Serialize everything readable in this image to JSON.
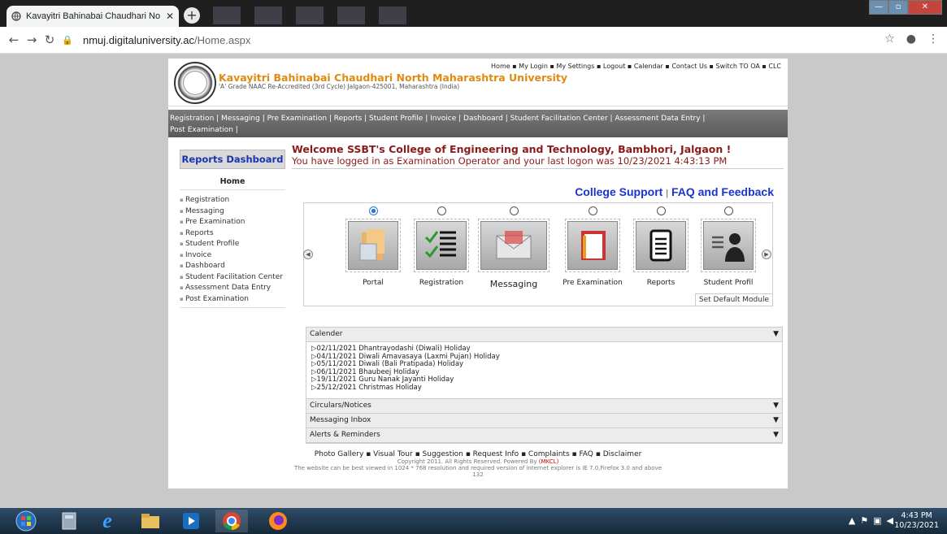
{
  "browser": {
    "tab_title": "Kavayitri Bahinabai Chaudhari No",
    "url_host": "nmuj.digitaluniversity.ac",
    "url_path": "/Home.aspx"
  },
  "header": {
    "university_name": "Kavayitri Bahinabai Chaudhari North Maharashtra University",
    "university_sub": "'A' Grade NAAC Re-Accredited (3rd Cycle) Jalgaon-425001, Maharashtra (India)",
    "top_links": "Home  ▪ My Login  ▪ My Settings  ▪ Logout  ▪ Calendar  ▪ Contact Us  ▪ Switch TO OA  ▪ CLC"
  },
  "menu": {
    "line1": "Registration | Messaging | Pre Examination | Reports | Student Profile | Invoice | Dashboard | Student Facilitation Center | Assessment Data Entry |",
    "line2": "Post Examination |"
  },
  "sidebar": {
    "button": "Reports Dashboard",
    "home": "Home",
    "items": [
      "Registration",
      "Messaging",
      "Pre Examination",
      "Reports",
      "Student Profile",
      "Invoice",
      "Dashboard",
      "Student Facilitation Center",
      "Assessment Data Entry",
      "Post Examination"
    ]
  },
  "main": {
    "welcome": "Welcome SSBT's College of Engineering and Technology, Bambhori, Jalgaon !",
    "logged": "You have logged in as Examination Operator and your last logon was 10/23/2021 4:43:13 PM",
    "support": "College Support",
    "sep": "|",
    "faq": "FAQ and Feedback",
    "set_default": "Set Default Module"
  },
  "modules": [
    {
      "label": "Portal",
      "icon": "portal-icon",
      "selected": true
    },
    {
      "label": "Registration",
      "icon": "checklist-icon",
      "selected": false
    },
    {
      "label": "Messaging",
      "icon": "envelope-icon",
      "selected": false
    },
    {
      "label": "Pre Examination",
      "icon": "notepad-icon",
      "selected": false
    },
    {
      "label": "Reports",
      "icon": "document-icon",
      "selected": false
    },
    {
      "label": "Student Profil",
      "icon": "user-profile-icon",
      "selected": false
    }
  ],
  "accordion": {
    "calender": "Calender",
    "events": [
      "02/11/2021 Dhantrayodashi (Diwali) Holiday",
      "04/11/2021 Diwali Amavasaya (Laxmi Pujan) Holiday",
      "05/11/2021 Diwali (Bali Pratipada) Holiday",
      "06/11/2021 Bhaubeej Holiday",
      "19/11/2021 Guru Nanak Jayanti Holiday",
      "25/12/2021 Christmas Holiday"
    ],
    "circulars": "Circulars/Notices",
    "inbox": "Messaging Inbox",
    "alerts": "Alerts & Reminders"
  },
  "footer": {
    "links": "Photo Gallery  ▪ Visual Tour  ▪ Suggestion  ▪ Request Info  ▪ Complaints  ▪ FAQ  ▪ Disclaimer",
    "copyright": "Copyright 2011. All Rights Reserved. Powered By",
    "mkcl": "(MKCL)",
    "browser_note": "The website can be best viewed in 1024 * 768 resolution and required version of internet explorer is IE 7.0,Firefox 3.0 and above",
    "count": "132"
  },
  "taskbar": {
    "time": "4:43 PM",
    "date": "10/23/2021"
  }
}
